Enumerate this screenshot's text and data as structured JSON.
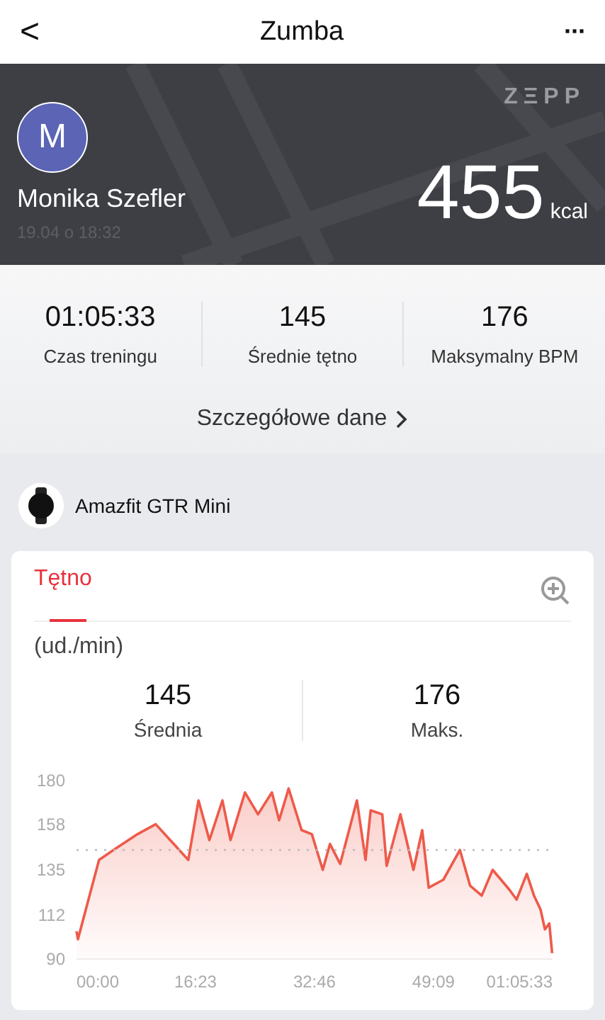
{
  "nav": {
    "back": "<",
    "title": "Zumba",
    "more": "···"
  },
  "header": {
    "brand": "ZΞPP",
    "avatar_letter": "M",
    "name": "Monika Szefler",
    "date": "19.04 o 18:32",
    "calories": "455",
    "calories_unit": "kcal"
  },
  "stats": [
    {
      "value": "01:05:33",
      "label": "Czas treningu"
    },
    {
      "value": "145",
      "label": "Średnie tętno"
    },
    {
      "value": "176",
      "label": "Maksymalny BPM"
    }
  ],
  "details_link": "Szczegółowe dane",
  "device": {
    "name": "Amazfit GTR Mini"
  },
  "card": {
    "tabs": [
      {
        "label": "Tętno",
        "selected": true
      }
    ],
    "unit": "(ud./min)",
    "summary": [
      {
        "value": "145",
        "label": "Średnia"
      },
      {
        "value": "176",
        "label": "Maks."
      }
    ],
    "chart_data": {
      "type": "area",
      "ylim": [
        90,
        180
      ],
      "xlim": [
        0,
        65.55
      ],
      "yticks": [
        90,
        112,
        135,
        158,
        180
      ],
      "xticks": [
        {
          "value": 0,
          "label": "00:00"
        },
        {
          "value": 16.38,
          "label": "16:23"
        },
        {
          "value": 32.77,
          "label": "32:46"
        },
        {
          "value": 49.15,
          "label": "49:09"
        },
        {
          "value": 65.55,
          "label": "01:05:33"
        }
      ],
      "x": [
        0,
        0.2,
        1.8,
        3.1,
        5.1,
        8.4,
        10.9,
        15.4,
        16.8,
        18.3,
        20.1,
        21.2,
        23.2,
        25.0,
        26.9,
        27.9,
        29.2,
        31.0,
        32.4,
        33.9,
        34.9,
        36.3,
        38.6,
        39.8,
        40.5,
        42.1,
        42.7,
        44.6,
        46.4,
        47.6,
        48.5,
        50.5,
        52.8,
        54.2,
        55.8,
        57.3,
        59.6,
        60.6,
        62.0,
        63.0,
        63.9,
        64.5,
        65.1,
        65.5
      ],
      "series": [
        {
          "color": "#ee5a4a",
          "values": [
            104,
            100,
            122,
            140,
            145,
            153,
            158,
            140,
            170,
            150,
            170,
            150,
            174,
            163,
            174,
            160,
            176,
            155,
            153,
            135,
            148,
            138,
            170,
            140,
            165,
            163,
            137,
            163,
            135,
            155,
            126,
            130,
            145,
            127,
            122,
            135,
            125,
            120,
            133,
            122,
            115,
            105,
            108,
            93
          ]
        }
      ],
      "ref_lines": [
        {
          "axis": "y",
          "value": 145
        }
      ]
    }
  }
}
